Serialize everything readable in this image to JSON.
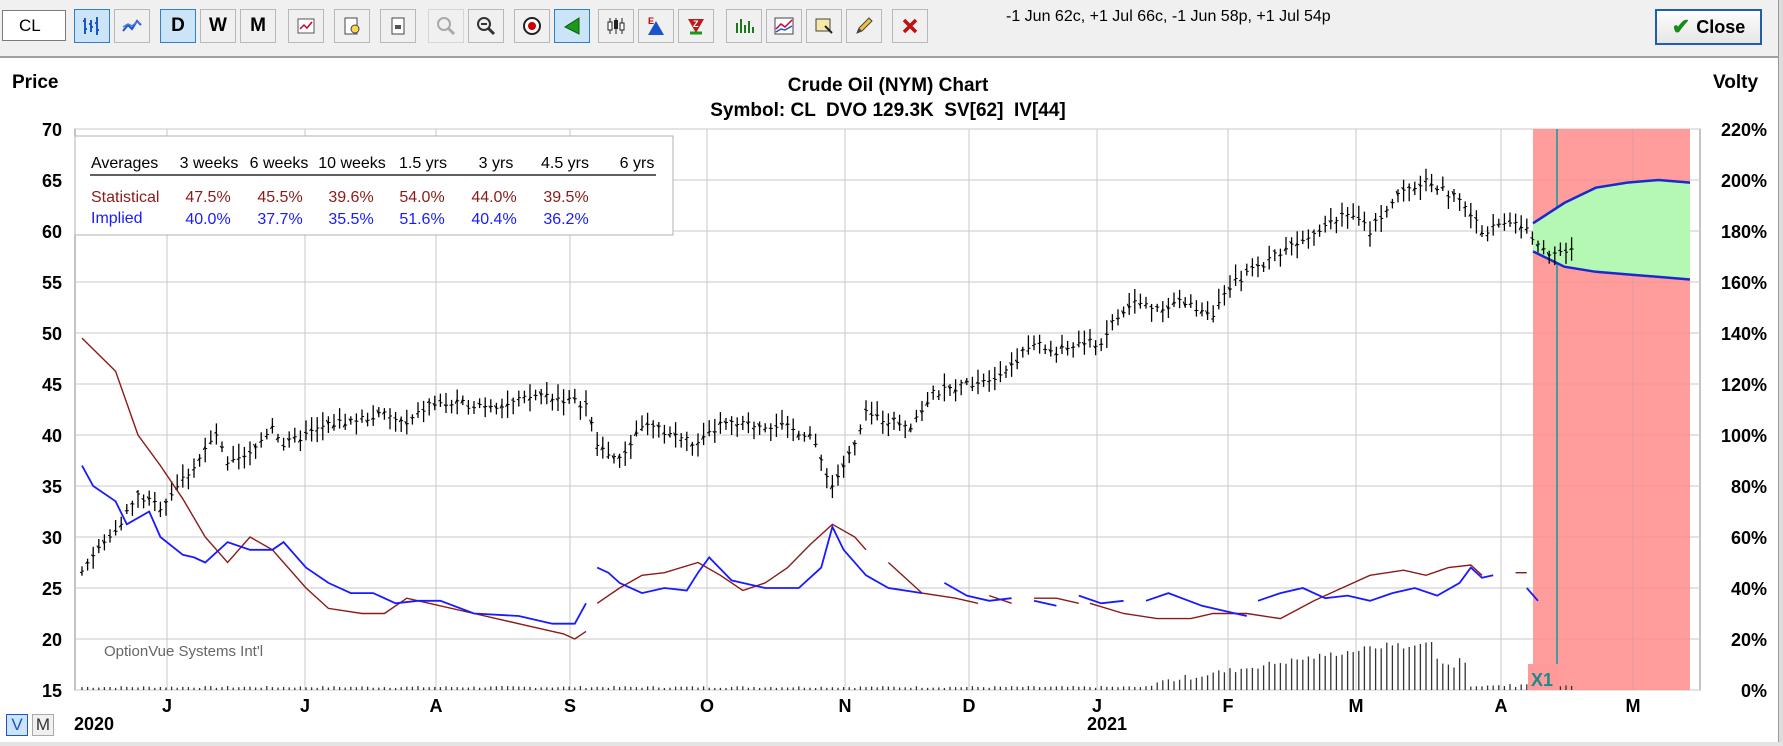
{
  "toolbar": {
    "symbol_value": "CL",
    "period_buttons": [
      "D",
      "W",
      "M"
    ],
    "strategy_text": "-1 Jun 62c, +1 Jul 66c, -1 Jun 58p, +1 Jul 54p",
    "close_label": "Close",
    "icons": [
      "bar-chart-icon",
      "line-chart-icon",
      "daily-button",
      "weekly-button",
      "monthly-button",
      "chart-settings-icon",
      "print-preview-icon",
      "print-icon",
      "zoom-in-icon",
      "zoom-out-icon",
      "target-icon",
      "arrow-icon",
      "candlestick-icon",
      "E-marker-icon",
      "Z-marker-icon",
      "volume-bars-icon",
      "volatility-lines-icon",
      "annotate-icon",
      "pencil-icon",
      "delete-icon"
    ]
  },
  "footer": {
    "v_label": "V",
    "m_label": "M"
  },
  "chart_data": {
    "type": "line",
    "title": "Crude Oil (NYM) Chart",
    "subtitle": "Symbol: CL  DVO 129.3K  SV[62]  IV[44]",
    "ylabel": "Price",
    "y2label": "Volty",
    "ylim": [
      15,
      70
    ],
    "y2lim": [
      0,
      220
    ],
    "y_ticks": [
      15,
      20,
      25,
      30,
      35,
      40,
      45,
      50,
      55,
      60,
      65,
      70
    ],
    "y2_ticks": [
      "0%",
      "20%",
      "40%",
      "60%",
      "80%",
      "100%",
      "120%",
      "140%",
      "160%",
      "180%",
      "200%",
      "220%"
    ],
    "x_months": [
      "J",
      "J",
      "A",
      "S",
      "O",
      "N",
      "D",
      "J",
      "F",
      "M",
      "A",
      "M"
    ],
    "x_years": [
      "2020",
      "2021"
    ],
    "watermark": "OptionVue Systems Int'l",
    "marker_label": "X1",
    "grid": true,
    "colors": {
      "statistical": "#8b1a1a",
      "implied": "#1a1aff",
      "price": "#000000",
      "risk_zone": "#ff8c8c",
      "profit_zone": "#b4f8b4"
    },
    "averages_table": {
      "headers": [
        "Averages",
        "3 weeks",
        "6 weeks",
        "10 weeks",
        "1.5 yrs",
        "3 yrs",
        "4.5 yrs",
        "6 yrs"
      ],
      "rows": [
        {
          "name": "Statistical",
          "values": [
            "47.5%",
            "45.5%",
            "39.6%",
            "54.0%",
            "44.0%",
            "39.5%",
            ""
          ]
        },
        {
          "name": "Implied",
          "values": [
            "40.0%",
            "37.7%",
            "35.5%",
            "51.6%",
            "40.4%",
            "36.2%",
            ""
          ]
        }
      ]
    },
    "price_series": {
      "name": "Price",
      "anchors": [
        [
          0,
          27
        ],
        [
          5,
          30
        ],
        [
          10,
          34
        ],
        [
          14,
          33
        ],
        [
          20,
          37
        ],
        [
          24,
          40
        ],
        [
          26,
          37
        ],
        [
          30,
          38
        ],
        [
          34,
          41
        ],
        [
          36,
          39
        ],
        [
          44,
          41
        ],
        [
          54,
          42
        ],
        [
          58,
          41
        ],
        [
          62,
          43
        ],
        [
          76,
          43
        ],
        [
          82,
          44
        ],
        [
          90,
          43
        ],
        [
          92,
          39
        ],
        [
          96,
          37.5
        ],
        [
          100,
          41
        ],
        [
          106,
          40
        ],
        [
          110,
          39
        ],
        [
          114,
          41
        ],
        [
          124,
          41
        ],
        [
          130,
          40
        ],
        [
          134,
          35
        ],
        [
          138,
          39
        ],
        [
          140,
          42
        ],
        [
          148,
          41
        ],
        [
          152,
          44
        ],
        [
          164,
          46
        ],
        [
          170,
          49
        ],
        [
          174,
          48
        ],
        [
          178,
          49
        ],
        [
          182,
          49
        ],
        [
          184,
          51
        ],
        [
          188,
          53
        ],
        [
          192,
          52.5
        ],
        [
          196,
          53
        ],
        [
          202,
          52
        ],
        [
          206,
          55
        ],
        [
          214,
          58
        ],
        [
          220,
          60
        ],
        [
          226,
          62
        ],
        [
          230,
          60
        ],
        [
          234,
          63
        ],
        [
          240,
          65
        ],
        [
          246,
          63
        ],
        [
          250,
          60
        ],
        [
          256,
          61
        ],
        [
          262,
          58
        ],
        [
          266,
          58
        ]
      ],
      "n_bars": 267
    },
    "statistical_vol": {
      "name": "Statistical",
      "anchors": [
        [
          0,
          138
        ],
        [
          6,
          125
        ],
        [
          10,
          100
        ],
        [
          14,
          88
        ],
        [
          18,
          75
        ],
        [
          22,
          60
        ],
        [
          26,
          50
        ],
        [
          30,
          60
        ],
        [
          34,
          55
        ],
        [
          40,
          40
        ],
        [
          44,
          32
        ],
        [
          50,
          30
        ],
        [
          54,
          30
        ],
        [
          58,
          36
        ],
        [
          62,
          34
        ],
        [
          70,
          30
        ],
        [
          80,
          25
        ],
        [
          86,
          22
        ],
        [
          88,
          20
        ],
        [
          90,
          23
        ],
        [
          null,
          null
        ],
        [
          92,
          34
        ],
        [
          96,
          40
        ],
        [
          100,
          45
        ],
        [
          104,
          46
        ],
        [
          110,
          50
        ],
        [
          114,
          45
        ],
        [
          118,
          39
        ],
        [
          122,
          42
        ],
        [
          126,
          48
        ],
        [
          130,
          57
        ],
        [
          134,
          65
        ],
        [
          138,
          60
        ],
        [
          140,
          55
        ],
        [
          null,
          null
        ],
        [
          144,
          50
        ],
        [
          150,
          38
        ],
        [
          156,
          36
        ],
        [
          160,
          34
        ],
        [
          null,
          null
        ],
        [
          162,
          37
        ],
        [
          166,
          34
        ],
        [
          null,
          null
        ],
        [
          170,
          36
        ],
        [
          174,
          36
        ],
        [
          178,
          34
        ],
        [
          null,
          null
        ],
        [
          180,
          34
        ],
        [
          186,
          30
        ],
        [
          192,
          28
        ],
        [
          198,
          28
        ],
        [
          202,
          30
        ],
        [
          208,
          30
        ],
        [
          214,
          28
        ],
        [
          220,
          35
        ],
        [
          224,
          39
        ],
        [
          230,
          45
        ],
        [
          236,
          47
        ],
        [
          240,
          45
        ],
        [
          244,
          48
        ],
        [
          248,
          49
        ],
        [
          250,
          45
        ],
        [
          null,
          null
        ],
        [
          256,
          46
        ],
        [
          258,
          46
        ],
        [
          null,
          null
        ],
        [
          260,
          40
        ]
      ],
      "gaps_note": ""
    },
    "implied_vol": {
      "name": "Implied",
      "anchors": [
        [
          0,
          88
        ],
        [
          2,
          80
        ],
        [
          6,
          74
        ],
        [
          8,
          65
        ],
        [
          12,
          70
        ],
        [
          14,
          60
        ],
        [
          18,
          53
        ],
        [
          20,
          52
        ],
        [
          22,
          50
        ],
        [
          26,
          58
        ],
        [
          30,
          55
        ],
        [
          34,
          55
        ],
        [
          36,
          58
        ],
        [
          40,
          48
        ],
        [
          44,
          42
        ],
        [
          48,
          38
        ],
        [
          52,
          38
        ],
        [
          56,
          34
        ],
        [
          60,
          35
        ],
        [
          64,
          35
        ],
        [
          70,
          30
        ],
        [
          78,
          29
        ],
        [
          84,
          26
        ],
        [
          88,
          26
        ],
        [
          90,
          34
        ],
        [
          null,
          null
        ],
        [
          92,
          48
        ],
        [
          94,
          46
        ],
        [
          96,
          42
        ],
        [
          100,
          38
        ],
        [
          104,
          40
        ],
        [
          108,
          39
        ],
        [
          110,
          46
        ],
        [
          112,
          52
        ],
        [
          116,
          43
        ],
        [
          122,
          40
        ],
        [
          128,
          40
        ],
        [
          132,
          48
        ],
        [
          134,
          64
        ],
        [
          136,
          55
        ],
        [
          140,
          45
        ],
        [
          144,
          40
        ],
        [
          150,
          38
        ],
        [
          null,
          null
        ],
        [
          154,
          42
        ],
        [
          158,
          37
        ],
        [
          162,
          35
        ],
        [
          166,
          36
        ],
        [
          null,
          null
        ],
        [
          170,
          35
        ],
        [
          174,
          33
        ],
        [
          null,
          null
        ],
        [
          178,
          37
        ],
        [
          182,
          34
        ],
        [
          186,
          35
        ],
        [
          null,
          null
        ],
        [
          190,
          35
        ],
        [
          194,
          38
        ],
        [
          200,
          33
        ],
        [
          206,
          30
        ],
        [
          208,
          29
        ],
        [
          null,
          null
        ],
        [
          210,
          35
        ],
        [
          214,
          38
        ],
        [
          218,
          40
        ],
        [
          222,
          36
        ],
        [
          226,
          37
        ],
        [
          230,
          35
        ],
        [
          234,
          38
        ],
        [
          238,
          40
        ],
        [
          242,
          37
        ],
        [
          246,
          42
        ],
        [
          248,
          48
        ],
        [
          250,
          44
        ],
        [
          252,
          45
        ],
        [
          null,
          null
        ],
        [
          258,
          40
        ],
        [
          260,
          35
        ]
      ]
    },
    "projection": {
      "upper": [
        [
          0,
          183
        ],
        [
          0.2,
          191
        ],
        [
          0.4,
          197
        ],
        [
          0.6,
          199
        ],
        [
          0.8,
          200
        ],
        [
          1,
          199
        ]
      ],
      "lower": [
        [
          0,
          172
        ],
        [
          0.2,
          166
        ],
        [
          0.4,
          164
        ],
        [
          0.6,
          163
        ],
        [
          0.8,
          162
        ],
        [
          1,
          161
        ]
      ],
      "note": ""
    }
  }
}
